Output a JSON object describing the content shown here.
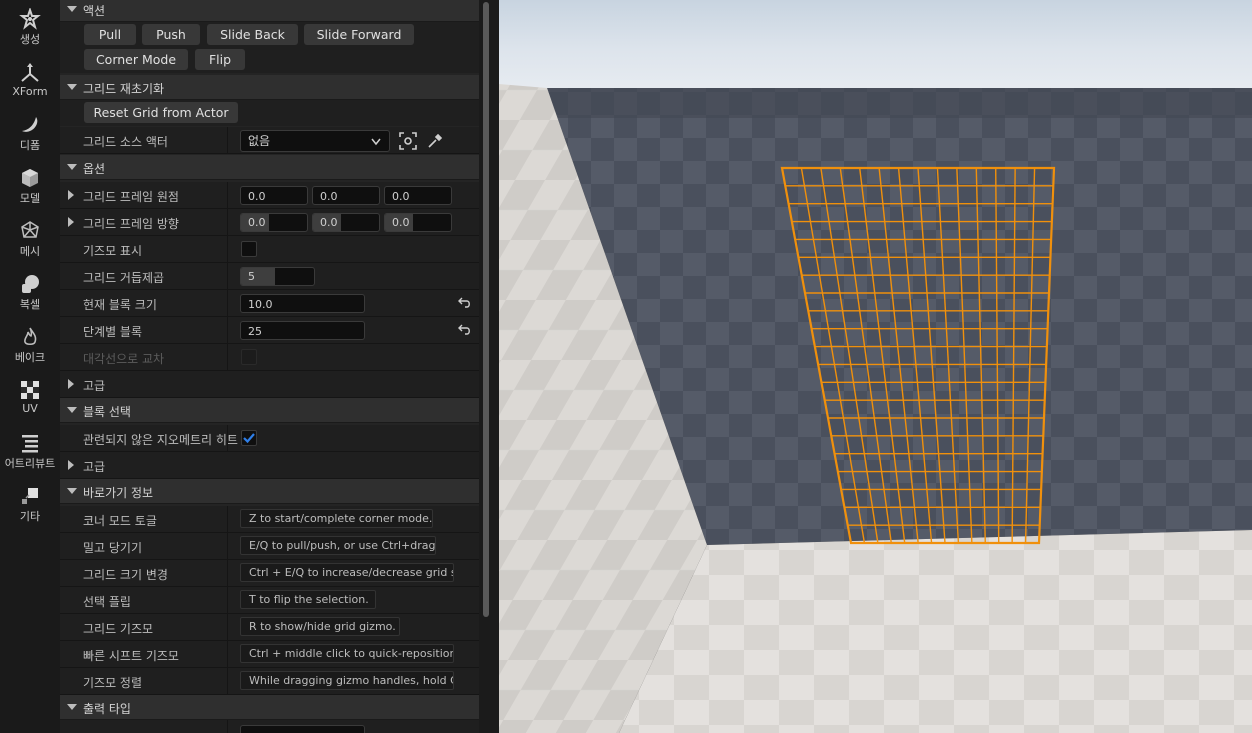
{
  "toolbar": {
    "items": [
      {
        "label": "생성",
        "icon": "create-star-icon"
      },
      {
        "label": "XForm",
        "icon": "xform-axis-icon"
      },
      {
        "label": "디폼",
        "icon": "deform-icon"
      },
      {
        "label": "모델",
        "icon": "model-cube-icon"
      },
      {
        "label": "메시",
        "icon": "mesh-icon"
      },
      {
        "label": "복셀",
        "icon": "voxel-icon"
      },
      {
        "label": "베이크",
        "icon": "bake-flame-icon"
      },
      {
        "label": "UV",
        "icon": "uv-checker-icon"
      },
      {
        "label": "어트리뷰트",
        "icon": "attributes-list-icon"
      },
      {
        "label": "기타",
        "icon": "misc-icon"
      }
    ]
  },
  "panel": {
    "actions": {
      "title": "액션",
      "buttons": [
        "Pull",
        "Push",
        "Slide Back",
        "Slide Forward",
        "Corner Mode",
        "Flip"
      ]
    },
    "grid_reinit": {
      "title": "그리드 재초기화",
      "reset_button": "Reset Grid from Actor",
      "source_label": "그리드 소스 액터",
      "source_value": "없음"
    },
    "options": {
      "title": "옵션",
      "frame_origin_label": "그리드 프레임 원점",
      "frame_origin": [
        "0.0",
        "0.0",
        "0.0"
      ],
      "frame_orientation_label": "그리드 프레임 방향",
      "frame_orientation": [
        "0.0",
        "0.0",
        "0.0"
      ],
      "show_gizmo_label": "기즈모 표시",
      "show_gizmo": false,
      "grid_power_label": "그리드 거듭제곱",
      "grid_power": "5",
      "block_size_label": "현재 블록 크기",
      "block_size": "10.0",
      "blocks_per_step_label": "단계별 블록",
      "blocks_per_step": "25",
      "diagonal_label": "대각선으로 교차",
      "advanced_label": "고급"
    },
    "block_select": {
      "title": "블록 선택",
      "hit_unrelated_label": "관련되지 않은 지오메트리 히트",
      "hit_unrelated": true,
      "advanced_label": "고급"
    },
    "shortcuts": {
      "title": "바로가기 정보",
      "rows": [
        {
          "label": "코너 모드 토글",
          "hint": "Z to start/complete corner mode."
        },
        {
          "label": "밀고 당기기",
          "hint": "E/Q to pull/push, or use Ctrl+drag."
        },
        {
          "label": "그리드 크기 변경",
          "hint": "Ctrl + E/Q to increase/decrease grid s"
        },
        {
          "label": "선택 플립",
          "hint": "T to flip the selection."
        },
        {
          "label": "그리드 기즈모",
          "hint": "R to show/hide grid gizmo."
        },
        {
          "label": "빠른 시프트 기즈모",
          "hint": "Ctrl + middle click to quick-reposition"
        },
        {
          "label": "기즈모 정렬",
          "hint": "While dragging gizmo handles, hold Ct"
        }
      ]
    },
    "output": {
      "title": "출력 타입"
    }
  },
  "colors": {
    "accent_orange": "#f0900c",
    "checkbox_blue": "#1f6fe0"
  }
}
